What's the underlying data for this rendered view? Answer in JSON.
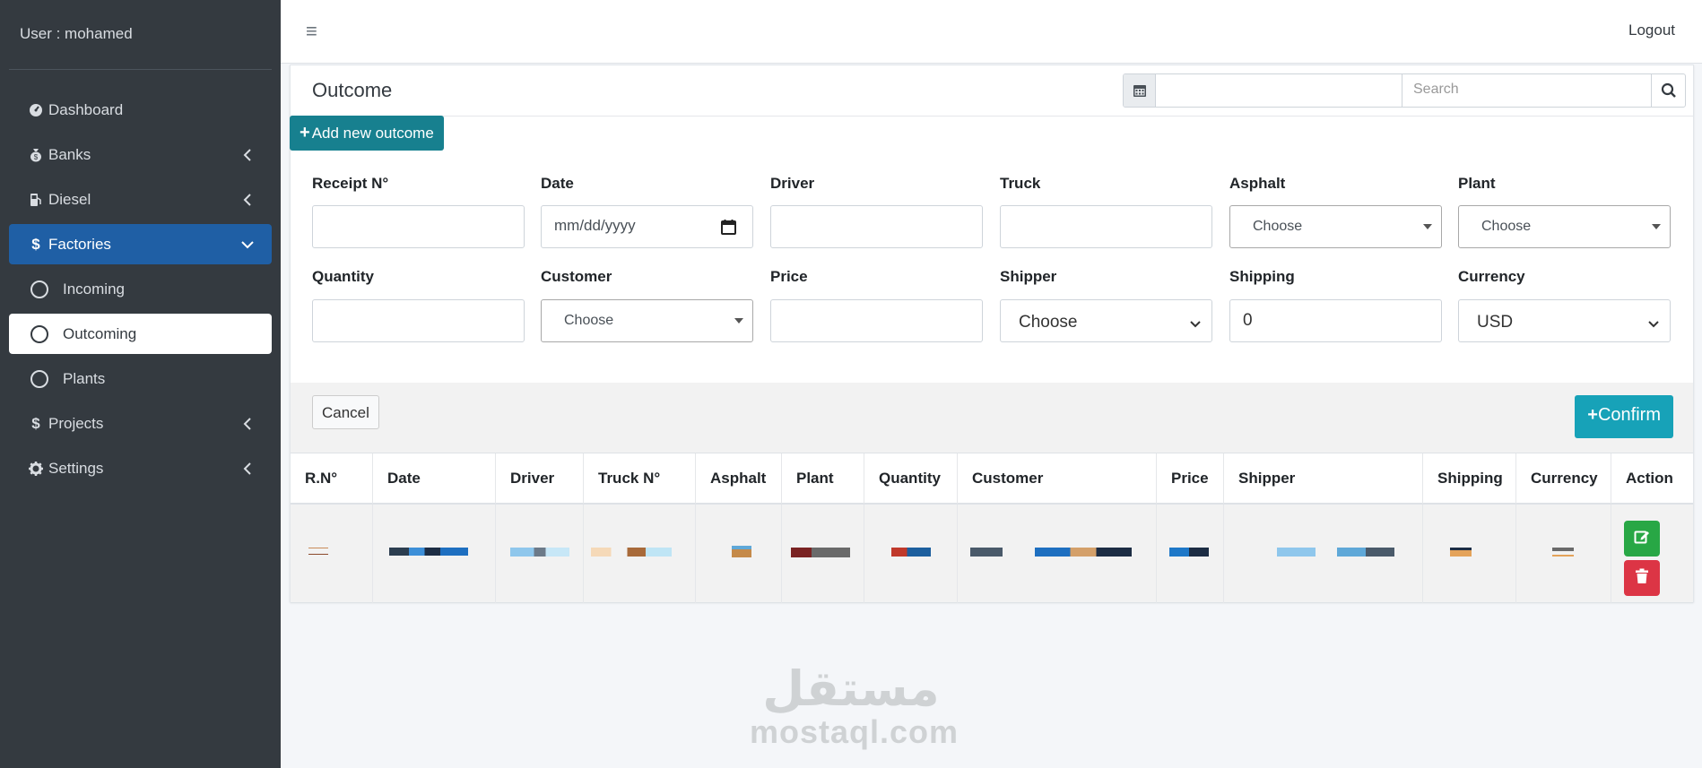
{
  "sidebar": {
    "user": "User : mohamed",
    "items": [
      {
        "label": "Dashboard",
        "icon": "dashboard-icon"
      },
      {
        "label": "Banks",
        "icon": "money-bag-icon"
      },
      {
        "label": "Diesel",
        "icon": "gas-pump-icon"
      },
      {
        "label": "Factories",
        "icon": "dollar-icon"
      },
      {
        "label": "Incoming",
        "icon": "circle-icon"
      },
      {
        "label": "Outcoming",
        "icon": "circle-icon"
      },
      {
        "label": "Plants",
        "icon": "circle-icon"
      },
      {
        "label": "Projects",
        "icon": "dollar-icon"
      },
      {
        "label": "Settings",
        "icon": "gear-icon"
      }
    ]
  },
  "topbar": {
    "logout": "Logout"
  },
  "page": {
    "title": "Outcome",
    "search_placeholder": "Search",
    "add_button": "Add new outcome"
  },
  "form": {
    "receipt_label": "Receipt N°",
    "date_label": "Date",
    "date_placeholder": "mm/dd/yyyy",
    "driver_label": "Driver",
    "truck_label": "Truck",
    "asphalt_label": "Asphalt",
    "asphalt_value": "Choose",
    "plant_label": "Plant",
    "plant_value": "Choose",
    "quantity_label": "Quantity",
    "customer_label": "Customer",
    "customer_value": "Choose",
    "price_label": "Price",
    "shipper_label": "Shipper",
    "shipper_value": "Choose",
    "shipping_label": "Shipping",
    "shipping_value": "0",
    "currency_label": "Currency",
    "currency_value": "USD",
    "cancel": "Cancel",
    "confirm": "Confirm"
  },
  "table": {
    "headers": [
      "R.N°",
      "Date",
      "Driver",
      "Truck N°",
      "Asphalt",
      "Plant",
      "Quantity",
      "Customer",
      "Price",
      "Shipper",
      "Shipping",
      "Currency",
      "Action"
    ]
  },
  "watermark": {
    "arabic": "مستقل",
    "latin": "mostaql.com"
  },
  "colors": {
    "sidebar": "#343a40",
    "active": "#1f5fa5",
    "add_button": "#17808f",
    "confirm": "#17a2b8",
    "edit": "#28a745",
    "delete": "#dc3545"
  }
}
